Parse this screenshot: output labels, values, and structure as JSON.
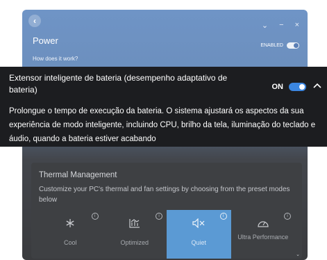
{
  "window": {
    "title": "Power",
    "how_link": "How does it work?",
    "enabled_label": "ENABLED",
    "controls": [
      "⌄",
      "−",
      "×"
    ]
  },
  "battery_extender": {
    "title": "Extensor inteligente de bateria (desempenho adaptativo de bateria)",
    "toggle_label": "ON",
    "toggle_on": true,
    "description": "Prolongue o tempo de execução da bateria. O sistema ajustará os aspectos da sua experiência de modo inteligente, incluindo CPU, brilho da tela, iluminação do teclado e áudio, quando a bateria estiver acabando"
  },
  "thermal": {
    "title": "Thermal Management",
    "description": "Customize your PC's thermal and fan settings by choosing from the preset modes below",
    "modes": [
      {
        "label": "Cool",
        "icon": "snowflake-icon",
        "active": false
      },
      {
        "label": "Optimized",
        "icon": "chart-icon",
        "active": false
      },
      {
        "label": "Quiet",
        "icon": "mute-icon",
        "active": true
      },
      {
        "label": "Ultra Performance",
        "icon": "gauge-icon",
        "active": false
      }
    ]
  },
  "colors": {
    "accent": "#3b86e0",
    "header_blue": "#6f94c6",
    "overlay_bg": "#1c1d20",
    "quiet_active": "#5b9ad4"
  }
}
